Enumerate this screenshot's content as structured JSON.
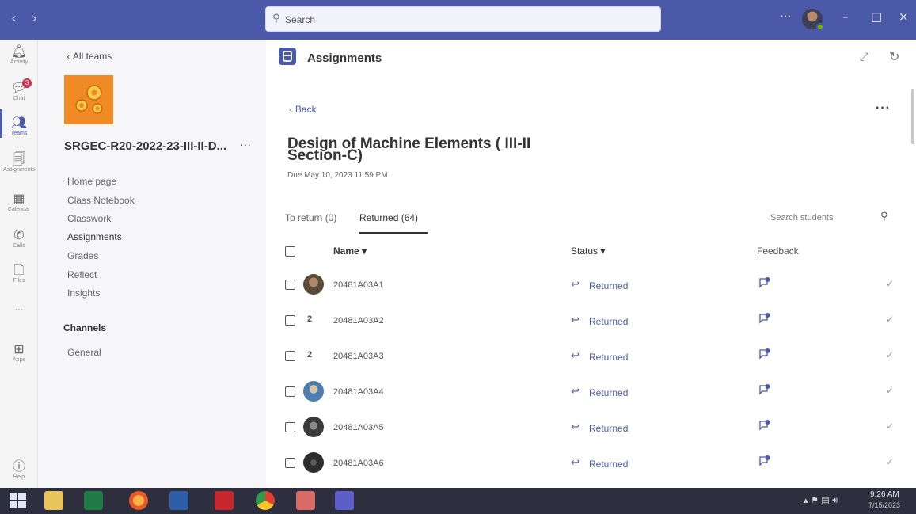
{
  "titlebar": {
    "search_placeholder": "Search",
    "more": "···",
    "minimize": "–",
    "maximize": "□",
    "close": "×"
  },
  "rail": [
    {
      "label": "Activity",
      "icon": "bell-icon"
    },
    {
      "label": "Chat",
      "icon": "chat-icon",
      "badge": "3"
    },
    {
      "label": "Teams",
      "icon": "teams-icon",
      "active": true
    },
    {
      "label": "Assignments",
      "icon": "assignments-icon"
    },
    {
      "label": "Calendar",
      "icon": "calendar-icon"
    },
    {
      "label": "Calls",
      "icon": "phone-icon"
    },
    {
      "label": "Files",
      "icon": "file-icon"
    },
    {
      "label": "···",
      "icon": "more-icon"
    },
    {
      "label": "Apps",
      "icon": "apps-icon"
    },
    {
      "label": "Help",
      "icon": "help-icon"
    }
  ],
  "sidebar": {
    "back_label": "All teams",
    "team_name": "SRGEC-R20-2022-23-III-II-D...",
    "team_more": "···",
    "nav": [
      "Home page",
      "Class Notebook",
      "Classwork",
      "Assignments",
      "Grades",
      "Reflect",
      "Insights"
    ],
    "active_nav": "Assignments",
    "channels_heading": "Channels",
    "channels": [
      "General"
    ]
  },
  "main": {
    "app_title": "Assignments",
    "back_label": "Back",
    "more": "···",
    "assignment_title": "Design of Machine Elements ( III-II Section-C)",
    "due": "Due May 10, 2023 11:59 PM",
    "tabs": [
      {
        "label": "To return (0)",
        "active": false
      },
      {
        "label": "Returned (64)",
        "active": true
      }
    ],
    "search_placeholder": "Search students",
    "columns": {
      "name": "Name ▾",
      "status": "Status ▾",
      "feedback": "Feedback"
    },
    "rows": [
      {
        "id": "20481A03A1",
        "avatar": "photo",
        "avatar_color": "#5a4a3a",
        "status": "Returned"
      },
      {
        "id": "20481A03A2",
        "avatar": "2",
        "status": "Returned"
      },
      {
        "id": "20481A03A3",
        "avatar": "2",
        "status": "Returned"
      },
      {
        "id": "20481A03A4",
        "avatar": "photo",
        "avatar_color": "#4c7db0",
        "status": "Returned"
      },
      {
        "id": "20481A03A5",
        "avatar": "photo",
        "avatar_color": "#3a3a3a",
        "status": "Returned"
      },
      {
        "id": "20481A03A6",
        "avatar": "photo",
        "avatar_color": "#2c2c2c",
        "status": "Returned"
      }
    ]
  },
  "taskbar": {
    "time": "9:26 AM",
    "date": "7/15/2023",
    "apps": [
      "start-icon",
      "file-explorer-icon",
      "excel-icon",
      "firefox-icon",
      "word-icon",
      "acrobat-icon",
      "chrome-icon",
      "paint-icon",
      "teams-icon"
    ]
  },
  "colors": {
    "accent": "#4a5aa8",
    "titlebar": "#4a5aa8",
    "team_logo": "#f08a24",
    "taskbar": "#2d2f3e"
  }
}
